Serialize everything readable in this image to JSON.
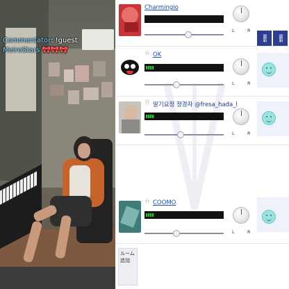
{
  "chat": {
    "lines": [
      {
        "name": "Commentator",
        "text": ": !guest"
      },
      {
        "name": "MeiroStars",
        "text": "",
        "hearts": "🎀🎀🎀"
      }
    ]
  },
  "side_tabs": [
    "最新",
    "最新"
  ],
  "room_button": {
    "label": "ルーム 追加"
  },
  "participants": [
    {
      "name": "Charmingio",
      "level": 0.0,
      "slider": 0.55,
      "show_star": false
    },
    {
      "name": "OK",
      "level": 0.12,
      "slider": 0.4,
      "show_star": true
    },
    {
      "name": "딸기요정 정경자 @fresa_hada_l",
      "level": 0.12,
      "slider": 0.45,
      "show_star": true
    },
    {
      "name": "COOMO",
      "level": 0.12,
      "slider": 0.4,
      "show_star": true
    }
  ],
  "labels": {
    "left": "L",
    "right": "R",
    "star": "☆"
  },
  "colors": {
    "accent": "#2d3d8f",
    "username": "#1b4ec7",
    "meter_green": "#29c23a"
  }
}
